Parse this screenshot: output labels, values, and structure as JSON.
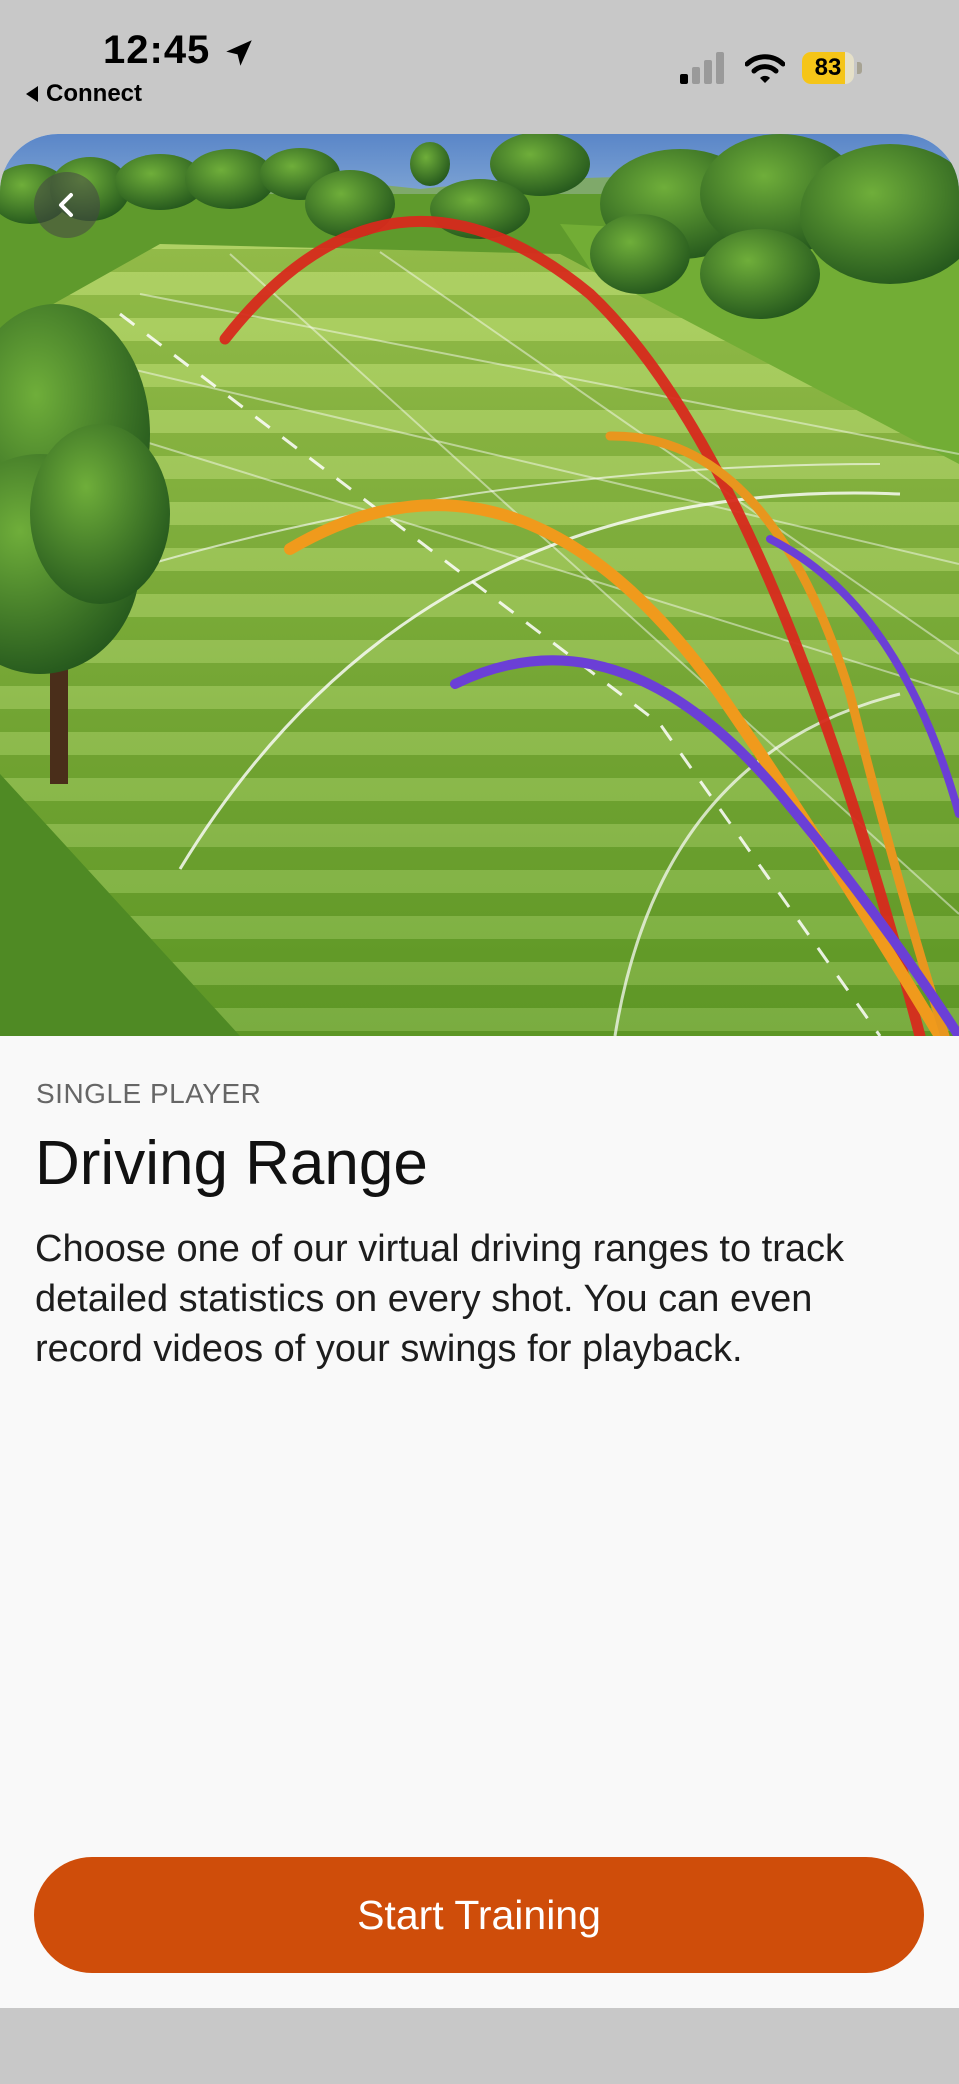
{
  "status_bar": {
    "time": "12:45",
    "back_app_label": "Connect",
    "battery_percent": "83",
    "battery_level": 0.83
  },
  "hero": {
    "scene_icon": "driving-range-scene",
    "back_icon": "chevron-left-icon"
  },
  "content": {
    "mode_label": "SINGLE PLAYER",
    "title": "Driving Range",
    "description": "Choose one of our virtual driving ranges to track detailed statistics on every shot. You can even record videos of your swings for playback."
  },
  "actions": {
    "start_label": "Start Training",
    "start_color": "#cf4d0a"
  }
}
